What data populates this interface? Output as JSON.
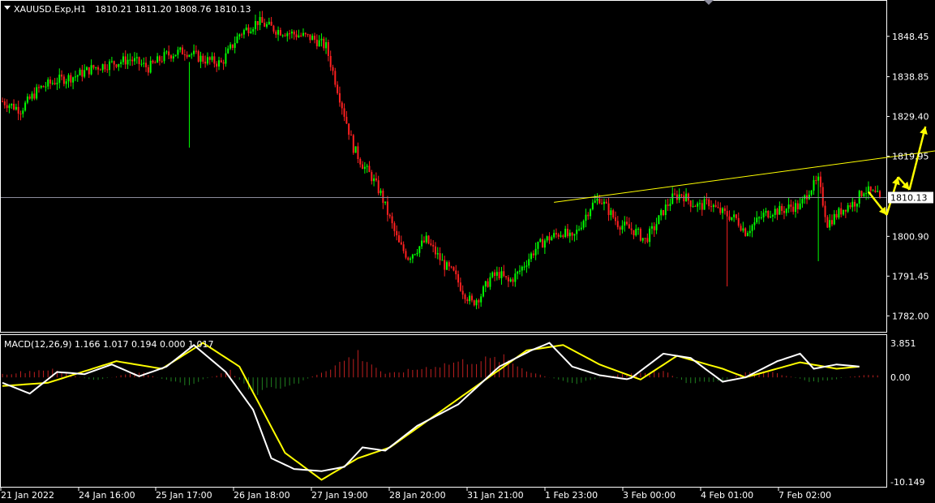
{
  "header": {
    "symbol": "XAUUSD.Exp,H1",
    "ohlc": "1810.21 1811.20 1808.76 1810.13"
  },
  "macd_header": "MACD(12,26,9) 1.166 1.017 0.194 0.000 1.017",
  "colors": {
    "background": "#000000",
    "bull": "#00ff00",
    "bear": "#ff2020",
    "grid_frame": "#ffffff",
    "trendline": "#ffff00",
    "price_line": "#8c8c9c",
    "macd_main": "#ffffff",
    "macd_signal": "#ffff00",
    "hist_pos": "#c02020",
    "hist_neg": "#208020"
  },
  "icons": {
    "menu": "triangle-down-icon",
    "scroll": "shift-marker-icon"
  },
  "chart_data": [
    {
      "type": "candlestick",
      "title": "XAUUSD.Exp,H1",
      "x_ticks": [
        "21 Jan 2022",
        "24 Jan 16:00",
        "25 Jan 17:00",
        "26 Jan 18:00",
        "27 Jan 19:00",
        "28 Jan 20:00",
        "31 Jan 21:00",
        "1 Feb 23:00",
        "3 Feb 00:00",
        "4 Feb 01:00",
        "7 Feb 02:00"
      ],
      "y_ticks": [
        "1848.45",
        "1838.85",
        "1829.40",
        "1819.95",
        "1810.13",
        "1800.90",
        "1791.45",
        "1782.00"
      ],
      "y_tick_values": [
        1848.45,
        1838.85,
        1829.4,
        1819.95,
        1810.13,
        1800.9,
        1791.45,
        1782.0
      ],
      "ylim": [
        1778.4,
        1856.7
      ],
      "current_price": 1810.13,
      "current_price_label": "1810.13",
      "close_path": [
        [
          0,
          1833
        ],
        [
          8,
          1831
        ],
        [
          16,
          1836
        ],
        [
          24,
          1838
        ],
        [
          32,
          1839
        ],
        [
          40,
          1841
        ],
        [
          48,
          1842
        ],
        [
          56,
          1843
        ],
        [
          64,
          1841
        ],
        [
          72,
          1844
        ],
        [
          80,
          1845
        ],
        [
          88,
          1843
        ],
        [
          96,
          1842
        ],
        [
          104,
          1849
        ],
        [
          112,
          1852
        ],
        [
          120,
          1850
        ],
        [
          128,
          1849
        ],
        [
          136,
          1848
        ],
        [
          142,
          1846
        ],
        [
          146,
          1838
        ],
        [
          150,
          1830
        ],
        [
          154,
          1822
        ],
        [
          158,
          1818
        ],
        [
          162,
          1815
        ],
        [
          166,
          1811
        ],
        [
          170,
          1805
        ],
        [
          174,
          1799
        ],
        [
          178,
          1796
        ],
        [
          182,
          1798
        ],
        [
          186,
          1800
        ],
        [
          190,
          1797
        ],
        [
          194,
          1794
        ],
        [
          198,
          1792
        ],
        [
          202,
          1788
        ],
        [
          206,
          1785
        ],
        [
          210,
          1787
        ],
        [
          214,
          1791
        ],
        [
          218,
          1792
        ],
        [
          222,
          1790
        ],
        [
          226,
          1792
        ],
        [
          230,
          1795
        ],
        [
          234,
          1798
        ],
        [
          238,
          1800
        ],
        [
          242,
          1801
        ],
        [
          246,
          1802
        ],
        [
          250,
          1800
        ],
        [
          254,
          1804
        ],
        [
          258,
          1808
        ],
        [
          262,
          1810
        ],
        [
          266,
          1807
        ],
        [
          270,
          1804
        ],
        [
          274,
          1803
        ],
        [
          278,
          1802
        ],
        [
          282,
          1800
        ],
        [
          286,
          1803
        ],
        [
          290,
          1807
        ],
        [
          294,
          1810
        ],
        [
          298,
          1811
        ],
        [
          302,
          1809
        ],
        [
          306,
          1808
        ],
        [
          310,
          1809
        ],
        [
          314,
          1807
        ],
        [
          318,
          1806
        ],
        [
          322,
          1805
        ],
        [
          326,
          1802
        ],
        [
          330,
          1804
        ],
        [
          334,
          1806
        ],
        [
          338,
          1807
        ],
        [
          342,
          1807
        ],
        [
          346,
          1808
        ],
        [
          350,
          1808
        ],
        [
          354,
          1812
        ],
        [
          358,
          1814
        ],
        [
          362,
          1804
        ],
        [
          366,
          1806
        ],
        [
          370,
          1808
        ],
        [
          374,
          1809
        ],
        [
          378,
          1812
        ],
        [
          382,
          1811
        ],
        [
          385,
          1810.13
        ]
      ],
      "candle_count": 386,
      "spikes": [
        {
          "index": 82,
          "direction": "up",
          "extent": 1822
        },
        {
          "index": 318,
          "direction": "down",
          "extent": 1789
        },
        {
          "index": 358,
          "direction": "down",
          "extent": 1795
        }
      ],
      "trendline": {
        "from": [
          242,
          1809.0
        ],
        "to": [
          420,
          1822.0
        ]
      },
      "arrow_path": [
        [
          380,
          1811.5
        ],
        [
          388,
          1806
        ],
        [
          393,
          1815
        ],
        [
          398,
          1812
        ],
        [
          405,
          1827
        ]
      ]
    },
    {
      "type": "macd",
      "title": "MACD(12,26,9)",
      "y_ticks": [
        "3.851",
        "0.00",
        "-10.149"
      ],
      "y_tick_values": [
        3.851,
        0.0,
        -10.149
      ],
      "ylim": [
        -10.149,
        3.851
      ],
      "macd_line": [
        [
          0,
          -0.5
        ],
        [
          12,
          -1.5
        ],
        [
          24,
          0.5
        ],
        [
          36,
          0.3
        ],
        [
          48,
          1.2
        ],
        [
          60,
          0.1
        ],
        [
          72,
          1.0
        ],
        [
          84,
          3.0
        ],
        [
          98,
          0.5
        ],
        [
          110,
          -3.0
        ],
        [
          118,
          -7.5
        ],
        [
          128,
          -8.5
        ],
        [
          140,
          -8.7
        ],
        [
          150,
          -8.3
        ],
        [
          158,
          -6.5
        ],
        [
          168,
          -6.8
        ],
        [
          182,
          -4.5
        ],
        [
          200,
          -2.5
        ],
        [
          218,
          1.0
        ],
        [
          232,
          2.5
        ],
        [
          240,
          3.2
        ],
        [
          250,
          1.0
        ],
        [
          262,
          0.2
        ],
        [
          275,
          -0.2
        ],
        [
          290,
          2.2
        ],
        [
          302,
          1.8
        ],
        [
          316,
          -0.4
        ],
        [
          326,
          0.0
        ],
        [
          340,
          1.5
        ],
        [
          350,
          2.2
        ],
        [
          356,
          0.8
        ],
        [
          366,
          1.2
        ],
        [
          376,
          1.0
        ]
      ],
      "signal_line": [
        [
          0,
          -0.8
        ],
        [
          20,
          -0.5
        ],
        [
          50,
          1.5
        ],
        [
          70,
          0.8
        ],
        [
          88,
          3.2
        ],
        [
          104,
          1.0
        ],
        [
          124,
          -7.0
        ],
        [
          140,
          -9.5
        ],
        [
          156,
          -7.5
        ],
        [
          170,
          -6.5
        ],
        [
          190,
          -3.5
        ],
        [
          210,
          -0.5
        ],
        [
          230,
          2.5
        ],
        [
          246,
          3.0
        ],
        [
          262,
          1.2
        ],
        [
          280,
          -0.2
        ],
        [
          296,
          2.0
        ],
        [
          316,
          0.8
        ],
        [
          326,
          0.0
        ],
        [
          350,
          1.4
        ],
        [
          366,
          0.8
        ],
        [
          376,
          1.0
        ]
      ],
      "histogram": [
        [
          0,
          0.3
        ],
        [
          20,
          0.8
        ],
        [
          40,
          -0.3
        ],
        [
          60,
          0.5
        ],
        [
          80,
          -0.8
        ],
        [
          100,
          0.6
        ],
        [
          110,
          -1.5
        ],
        [
          125,
          -1.0
        ],
        [
          140,
          0.5
        ],
        [
          156,
          2.3
        ],
        [
          168,
          0.3
        ],
        [
          182,
          0.8
        ],
        [
          200,
          1.5
        ],
        [
          220,
          1.8
        ],
        [
          232,
          0.5
        ],
        [
          250,
          -0.6
        ],
        [
          270,
          0.3
        ],
        [
          290,
          0.6
        ],
        [
          300,
          -0.5
        ],
        [
          316,
          -0.4
        ],
        [
          326,
          0.6
        ],
        [
          340,
          0.4
        ],
        [
          356,
          -0.5
        ],
        [
          376,
          0.2
        ]
      ]
    }
  ]
}
